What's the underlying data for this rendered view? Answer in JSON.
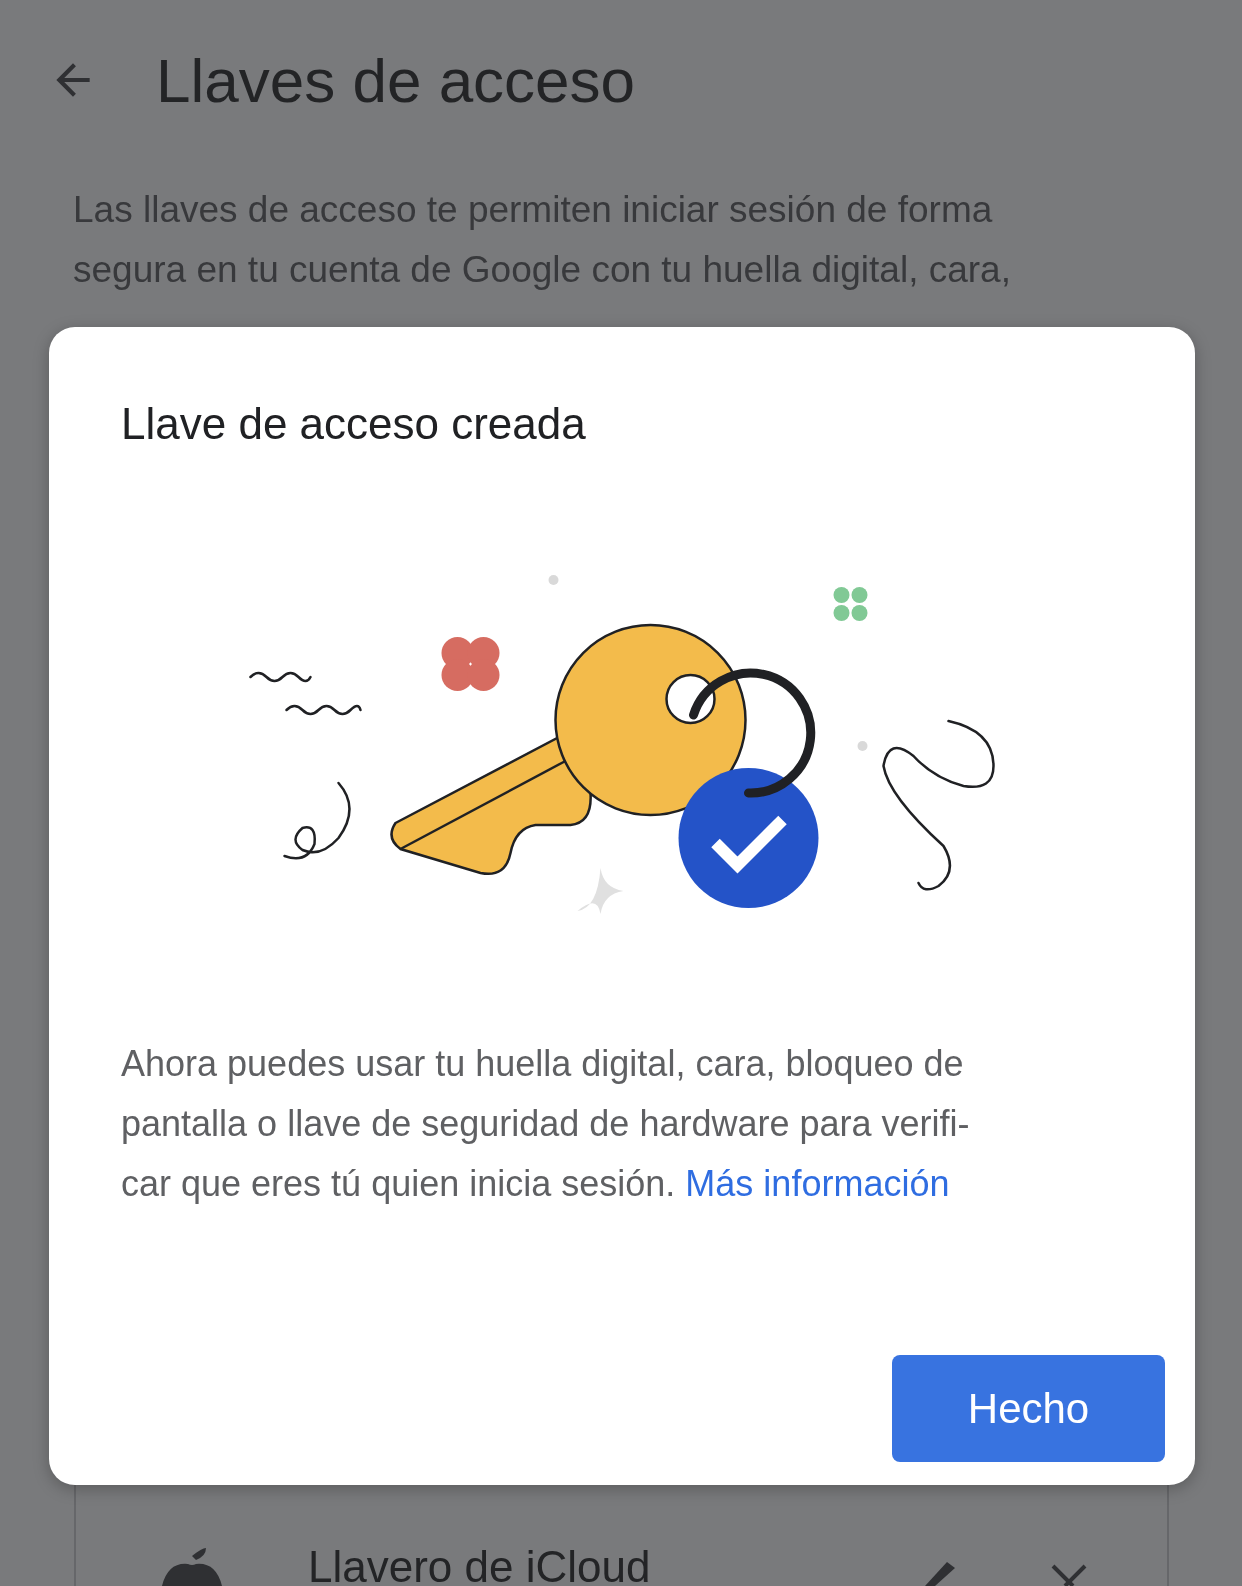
{
  "page": {
    "title": "Llaves de acceso",
    "description_lines": [
      "Las llaves de acceso te permiten iniciar sesión de forma",
      "segura en tu cuenta de Google con tu huella digital, cara,"
    ]
  },
  "passkeys": [
    {
      "name": "Llavero de iCloud"
    }
  ],
  "dialog": {
    "title": "Llave de acceso creada",
    "body_lines": [
      "Ahora puedes usar tu huella digital, cara, bloqueo de",
      "pantalla o llave de seguridad de hardware para verifi-",
      "car que eres tú quien inicia sesión."
    ],
    "link": "Más información",
    "button": "Hecho"
  }
}
